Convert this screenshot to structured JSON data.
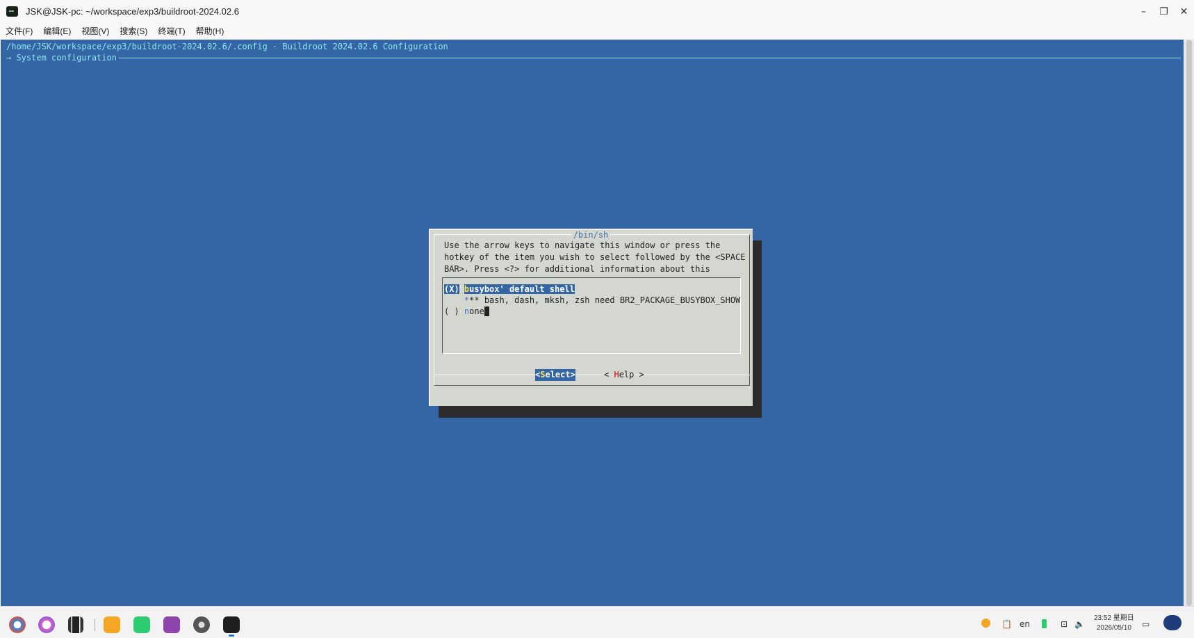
{
  "window": {
    "title": "JSK@JSK-pc: ~/workspace/exp3/buildroot-2024.02.6",
    "controls": {
      "minimize": "–",
      "restore": "❐",
      "close": "✕"
    }
  },
  "menubar": {
    "items": [
      "文件(F)",
      "编辑(E)",
      "视图(V)",
      "搜索(S)",
      "终端(T)",
      "帮助(H)"
    ]
  },
  "terminal": {
    "header_path": "/home/JSK/workspace/exp3/buildroot-2024.02.6/.config - Buildroot 2024.02.6 Configuration",
    "breadcrumb": "→ System configuration",
    "colors": {
      "background": "#3465a4",
      "header_text": "#8fe5f2",
      "dialog_bg": "#d3d7cf"
    }
  },
  "dialog": {
    "title": "/bin/sh",
    "help_lines": [
      "Use the arrow keys to navigate this window or press the",
      "hotkey of the item you wish to select followed by the <SPACE",
      "BAR>. Press <?> for additional information about this"
    ],
    "options": [
      {
        "marker": "(X)",
        "hotkey": "b",
        "rest": "usybox' default shell",
        "selected": true
      },
      {
        "marker": "",
        "hotkey": "*",
        "rest": "** bash, dash, mksh, zsh need BR2_PACKAGE_BUSYBOX_SHOW"
      },
      {
        "marker": "( )",
        "hotkey": "n",
        "rest": "one",
        "selected": false
      }
    ],
    "buttons": {
      "select": {
        "open": "<",
        "hotkey": "S",
        "rest": "elect>"
      },
      "help": {
        "open": "< ",
        "hotkey": "H",
        "rest": "elp >"
      }
    }
  },
  "taskbar": {
    "apps": [
      {
        "name": "launcher",
        "color": "#2f86e6"
      },
      {
        "name": "search",
        "color": "#e85fb0"
      },
      {
        "name": "multitask",
        "color": "#222222"
      },
      {
        "name": "file-manager",
        "color": "#f5a623"
      },
      {
        "name": "app-store",
        "color": "#2ecc71"
      },
      {
        "name": "camera",
        "color": "#8e44ad"
      },
      {
        "name": "settings",
        "color": "#555555"
      },
      {
        "name": "terminal",
        "color": "#1e1e1e"
      }
    ],
    "tray": {
      "lang": "en",
      "time": "23:52 星期日",
      "date": "2026/05/10"
    }
  }
}
